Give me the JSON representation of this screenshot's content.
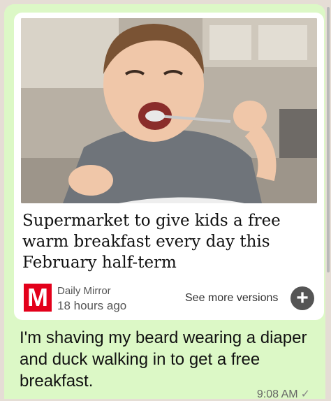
{
  "article": {
    "headline": "Supermarket to give kids a free warm breakfast every day this February half-term",
    "source_logo_letter": "M",
    "source_name": "Daily Mirror",
    "published": "18 hours ago",
    "see_more": "See more versions",
    "more_button_symbol": "+"
  },
  "message": {
    "text": "I'm shaving my beard wearing a diaper and duck walking in to get a free breakfast.",
    "time": "9:08 AM",
    "status_icon": "✓"
  },
  "colors": {
    "bubble": "#dcf8c6",
    "logo_red": "#e3001b"
  }
}
